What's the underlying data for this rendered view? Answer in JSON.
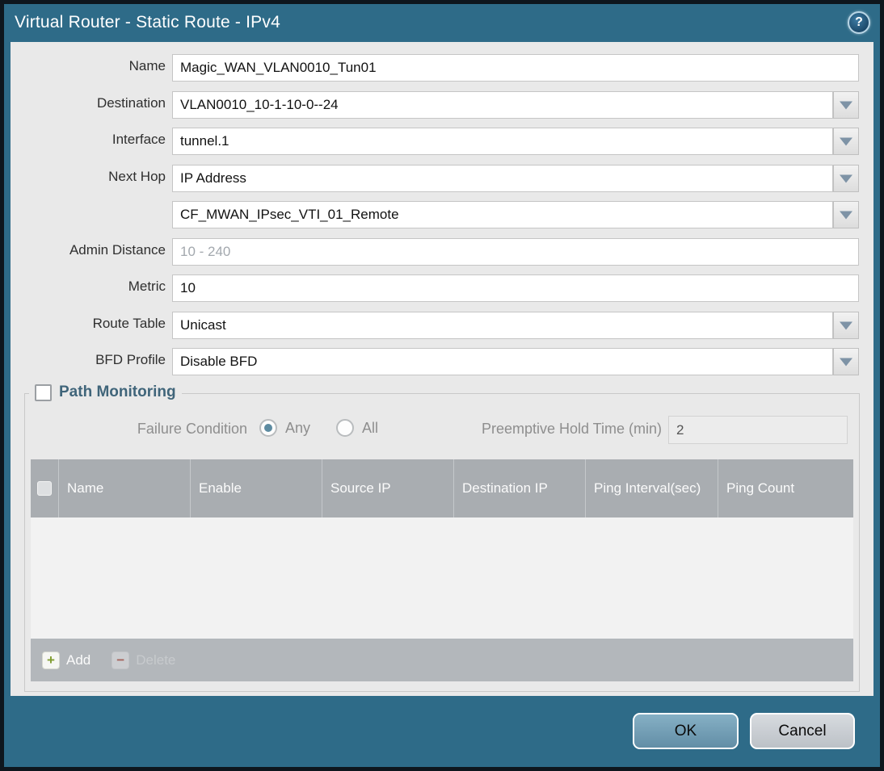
{
  "dialog": {
    "title": "Virtual Router - Static Route - IPv4",
    "help_icon_glyph": "?"
  },
  "form": {
    "fields": [
      {
        "label": "Name",
        "value": "Magic_WAN_VLAN0010_Tun01",
        "type": "text"
      },
      {
        "label": "Destination",
        "value": "VLAN0010_10-1-10-0--24",
        "type": "combo"
      },
      {
        "label": "Interface",
        "value": "tunnel.1",
        "type": "combo"
      },
      {
        "label": "Next Hop",
        "value": "IP Address",
        "type": "combo"
      },
      {
        "label": "",
        "value": "CF_MWAN_IPsec_VTI_01_Remote",
        "type": "combo"
      },
      {
        "label": "Admin Distance",
        "value": "",
        "placeholder": "10 - 240",
        "type": "text"
      },
      {
        "label": "Metric",
        "value": "10",
        "type": "text"
      },
      {
        "label": "Route Table",
        "value": "Unicast",
        "type": "combo"
      },
      {
        "label": "BFD Profile",
        "value": "Disable BFD",
        "type": "combo"
      }
    ]
  },
  "path_monitoring": {
    "title": "Path Monitoring",
    "checked": false,
    "failure_condition": {
      "label": "Failure Condition",
      "options": [
        {
          "label": "Any",
          "selected": true
        },
        {
          "label": "All",
          "selected": false
        }
      ]
    },
    "preemptive_hold_time": {
      "label": "Preemptive Hold Time (min)",
      "value": "2"
    },
    "table": {
      "headers": [
        "Name",
        "Enable",
        "Source IP",
        "Destination IP",
        "Ping Interval(sec)",
        "Ping Count"
      ],
      "rows": [],
      "add_label": "Add",
      "delete_label": "Delete"
    }
  },
  "footer": {
    "ok_label": "OK",
    "cancel_label": "Cancel"
  },
  "colors": {
    "frame": "#2e6b88",
    "frame_border": "#0e161d",
    "body_bg": "#e9e9e9",
    "field_border": "#c5c5c5",
    "arrow": "#7e93a6",
    "section_title": "#40657a",
    "disabled_text": "#8e8e8e",
    "th_bg": "#a9adb1",
    "tbody_bg": "#f2f2f2",
    "tfoot_bg": "#b3b7bb",
    "radio_sel": "#5d8ba1",
    "add_plus": "#7f9c2f",
    "del_minus": "#a5655e",
    "ok_bg": "#72a2bb",
    "cancel_bg": "#c9cdd2"
  }
}
